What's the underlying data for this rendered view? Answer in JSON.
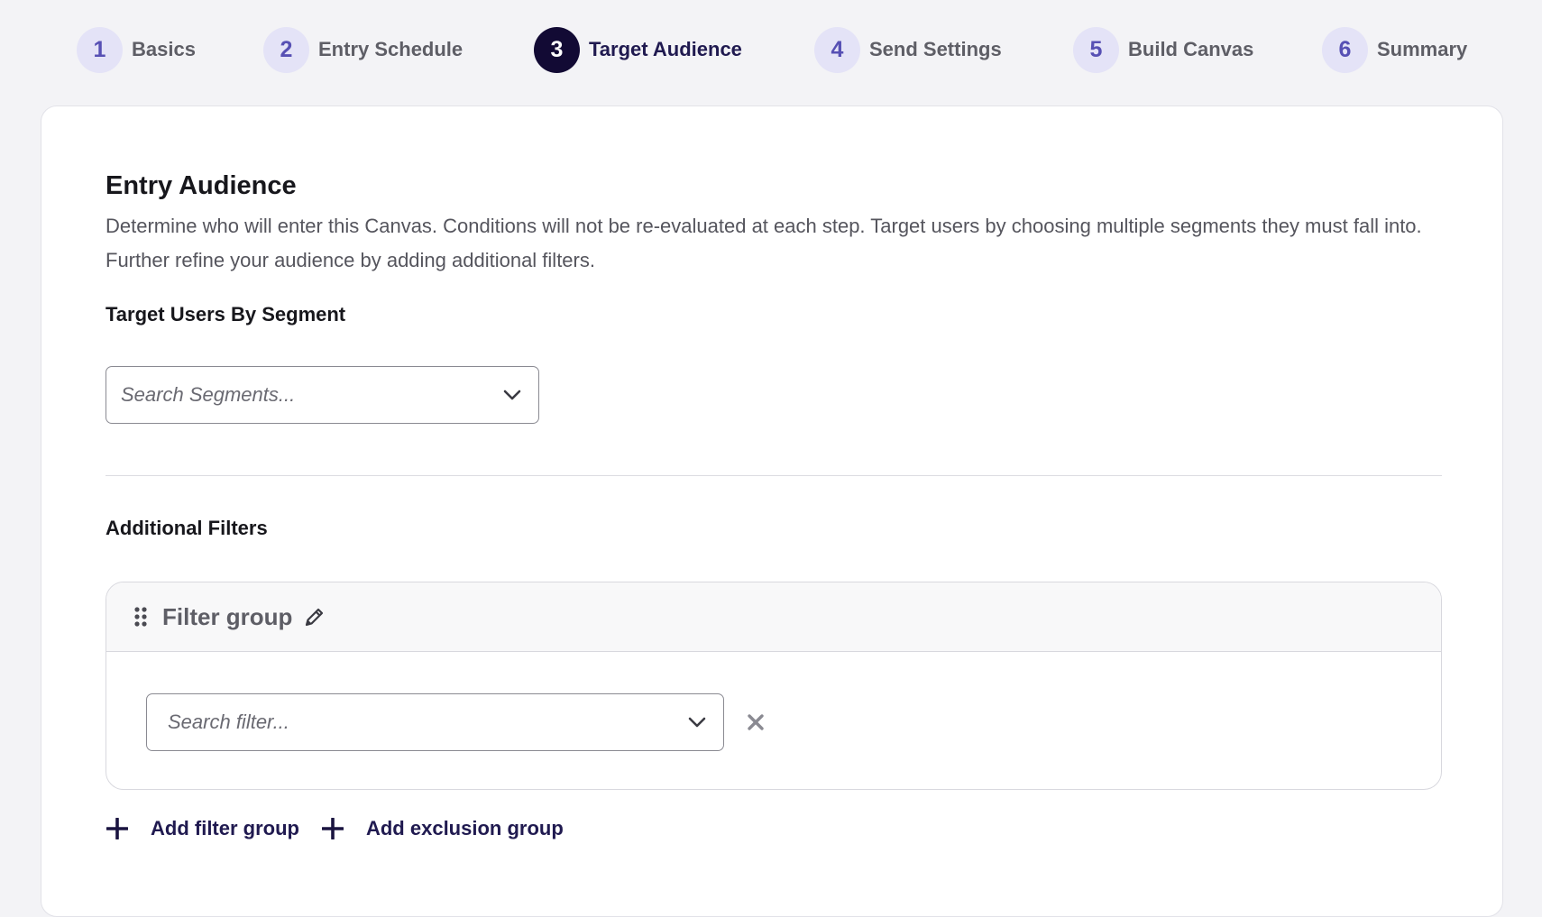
{
  "stepper": {
    "steps": [
      {
        "number": "1",
        "label": "Basics"
      },
      {
        "number": "2",
        "label": "Entry Schedule"
      },
      {
        "number": "3",
        "label": "Target Audience"
      },
      {
        "number": "4",
        "label": "Send Settings"
      },
      {
        "number": "5",
        "label": "Build Canvas"
      },
      {
        "number": "6",
        "label": "Summary"
      }
    ],
    "active_step": "3"
  },
  "entry_audience": {
    "title": "Entry Audience",
    "description": "Determine who will enter this Canvas. Conditions will not be re-evaluated at each step. Target users by choosing multiple segments they must fall into. Further refine your audience by adding additional filters."
  },
  "segments": {
    "label": "Target Users By Segment",
    "value": "",
    "placeholder": "Search Segments..."
  },
  "additional_filters": {
    "label": "Additional Filters",
    "filter_group": {
      "title": "Filter group",
      "filter_value": "",
      "filter_placeholder": "Search filter..."
    },
    "add_filter_group_label": "Add filter group",
    "add_exclusion_group_label": "Add exclusion group"
  },
  "icons": {
    "chevron": "chevron-down-icon",
    "drag": "drag-handle-icon",
    "edit": "pencil-icon",
    "remove": "close-icon",
    "add": "plus-icon"
  },
  "colors": {
    "page_background": "#f3f3f6",
    "active_step": "#120a34",
    "inactive_step_bg": "#e4e3f7",
    "inactive_step_text": "#5750b4",
    "link_text": "#201a50"
  }
}
